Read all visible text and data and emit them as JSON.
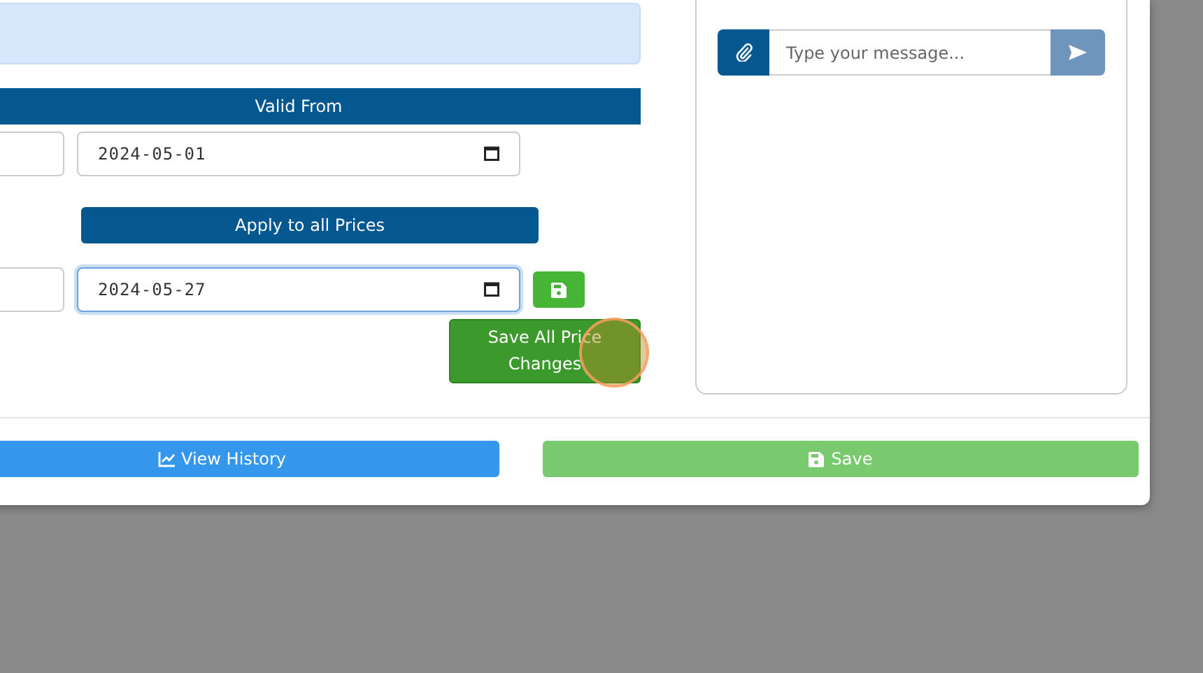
{
  "price_table": {
    "header": "Valid From",
    "rows": [
      {
        "kind": "price",
        "valid_from": "2024-05-01",
        "focused": false
      },
      {
        "kind": "apply",
        "label": "Apply to all Prices"
      },
      {
        "kind": "edit",
        "valid_from": "2024-05-27",
        "focused": true
      }
    ]
  },
  "save_all_button": "Save All Price Changes",
  "chat": {
    "placeholder": "Type your message..."
  },
  "footer": {
    "history_button": "View History",
    "save_button": "Save"
  }
}
